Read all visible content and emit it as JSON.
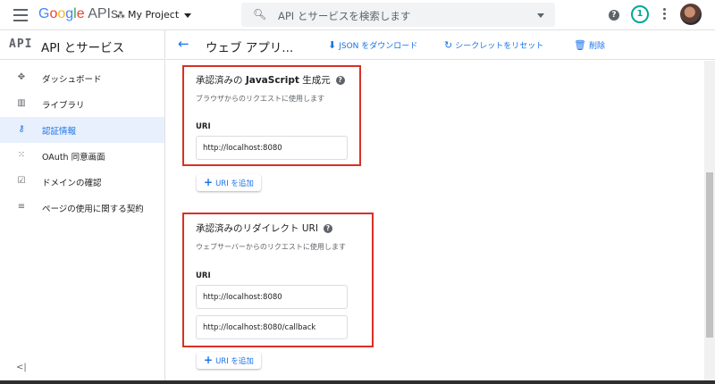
{
  "topbar": {
    "logo_google": "Google",
    "logo_apis": " APIs",
    "project_name": "My Project",
    "search_placeholder": "API とサービスを検索します",
    "notification_count": "1"
  },
  "sidebar": {
    "header_icon_text": "API",
    "header_title": "API とサービス",
    "items": [
      {
        "icon": "✥",
        "label": "ダッシュボード",
        "active": false
      },
      {
        "icon": "▥",
        "label": "ライブラリ",
        "active": false
      },
      {
        "icon": "⚷",
        "label": "認証情報",
        "active": true
      },
      {
        "icon": "⁙",
        "label": "OAuth 同意画面",
        "active": false
      },
      {
        "icon": "☑",
        "label": "ドメインの確認",
        "active": false
      },
      {
        "icon": "≡",
        "label": "ページの使用に関する契約",
        "active": false
      }
    ],
    "collapse_icon": "<|"
  },
  "main_header": {
    "back_icon": "←",
    "title": "ウェブ アプリ...",
    "download_label": "JSON をダウンロード",
    "reset_label": "シークレットをリセット",
    "delete_label": "削除"
  },
  "js_origins": {
    "title_pre": "承認済みの ",
    "title_bold": "JavaScript",
    "title_post": " 生成元",
    "description": "ブラウザからのリクエストに使用します",
    "uri_label": "URI",
    "uris": [
      "http://localhost:8080"
    ],
    "add_label": "URI を追加"
  },
  "redirect_uris": {
    "title": "承認済みのリダイレクト URI",
    "description": "ウェブサーバーからのリクエストに使用します",
    "uri_label": "URI",
    "uris": [
      "http://localhost:8080",
      "http://localhost:8080/callback"
    ],
    "add_label": "URI を追加"
  },
  "colors": {
    "accent": "#1a73e8",
    "highlight_border": "#d93025",
    "active_nav_bg": "#e8f0fe"
  }
}
